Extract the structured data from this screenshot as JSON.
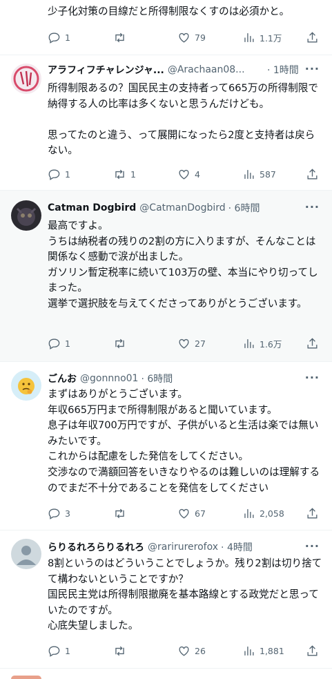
{
  "tweets": [
    {
      "body": "少子化対策の目線だと所得制限なくすのは必須かと。",
      "reply": "1",
      "retweet": "",
      "like": "79",
      "views": "1.1万"
    },
    {
      "name": "アラフィフチャレンジャ...",
      "handle": "@Arachaan08...",
      "time": "· 1時間",
      "body": "所得制限あるの？国民民主の支持者って665万の所得制限で納得する人の比率は多くないと思うんだけども。\n\n思ってたのと違う、って展開になったら2度と支持者は戻らない。",
      "reply": "1",
      "retweet": "1",
      "like": "4",
      "views": "587"
    },
    {
      "name": "Catman Dogbird",
      "handle": "@CatmanDogbird",
      "time": "· 6時間",
      "body": "最高ですよ。\nうちは納税者の残りの2割の方に入りますが、そんなことは関係なく感動で涙が出ました。\nガソリン暫定税率に続いて103万の壁、本当にやり切ってしまった。\n選挙で選択肢を与えてくださってありがとうございます。",
      "reply": "1",
      "retweet": "",
      "like": "27",
      "views": "1.6万"
    },
    {
      "name": "ごんお",
      "handle": "@gonnno01",
      "time": "· 6時間",
      "body": "まずはありがとうございます。\n年収665万円まで所得制限があると聞いています。\n息子は年収700万円ですが、子供がいると生活は楽では無いみたいです。\nこれからは配慮をした発信をしてください。\n交渉なので満額回答をいきなりやるのは難しいのは理解するのでまだ不十分であることを発信をしてください",
      "reply": "3",
      "retweet": "",
      "like": "67",
      "views": "2,058"
    },
    {
      "name": "らりるれろらりるれろ",
      "handle": "@rarirurerofox",
      "time": "· 4時間",
      "body": "8割というのはどういうことでしょうか。残り2割は切り捨てて構わないということですか？\n国民民主党は所得制限撤廃を基本路線とする政党だと思っていたのですが。\n心底失望しました。",
      "reply": "1",
      "retweet": "",
      "like": "26",
      "views": "1,881"
    }
  ]
}
